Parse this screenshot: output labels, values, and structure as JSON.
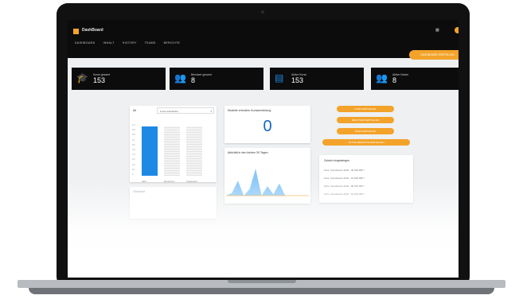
{
  "header": {
    "brand": "DashBoard",
    "nav": [
      "DASHBOARD",
      "INHALT",
      "HISTORY",
      "TEAMS",
      "BERICHTE"
    ],
    "top_button": "DASHBOARD ERSTELLEN"
  },
  "kpis": [
    {
      "icon": "graduation-cap-icon",
      "label": "Kurse gesamt",
      "value": "153",
      "color": "#1e88e5"
    },
    {
      "icon": "users-icon",
      "label": "Benutzer gesamt",
      "value": "8",
      "color": "#f3a32a"
    },
    {
      "icon": "calendar-icon",
      "label": "Aktive Kurse",
      "value": "153",
      "color": "#1e88e5"
    },
    {
      "icon": "users-icon",
      "label": "Aktive Nutzer",
      "value": "8",
      "color": "#f3a32a"
    }
  ],
  "chart_card": {
    "title": "All",
    "select": "Kurse aktualisiert",
    "chart_data": {
      "type": "bar",
      "categories": [
        "Aktiv",
        "Bestanden",
        "Abgelaufen"
      ],
      "values": [
        1.0,
        1.0,
        1.0
      ],
      "highlighted": 0,
      "yticks": [
        "1.0",
        "0.9",
        "0.8",
        "0.7",
        "0.6",
        "0.5",
        "0.4",
        "0.3",
        "0.2",
        "0.1",
        "0"
      ],
      "ylim": [
        0,
        1
      ]
    }
  },
  "zero_card": {
    "title": "Modelle erfordern Kursanmeldung",
    "value": "0"
  },
  "activity_card": {
    "title": "Aktivität in den letzten 30 Tagen",
    "chart_data": {
      "type": "area",
      "values": [
        0,
        0.1,
        0.55,
        0,
        0.25,
        1.0,
        0,
        0.35,
        0.05,
        0.45,
        0,
        0,
        0,
        0,
        0
      ]
    }
  },
  "actions": [
    "KURS ERSTELLEN",
    "BENUTZER ERSTELLEN",
    "TEAM ERSTELLEN",
    "AKTIVE BERICHTE ERSTELLEN"
  ],
  "recent": {
    "title": "Zuletzt eingestiegen",
    "rows": [
      "Kurs: Compliance 2024 - 45,000 MB.7",
      "Kurs: Compliance 2024 - 19,000 MB.7",
      "Kurs: Compliance 2024 - 88,000 MB.7",
      "Kurs: Compliance 2024 - 64,000 MB.7"
    ]
  },
  "bottom_label": "Übersicht"
}
